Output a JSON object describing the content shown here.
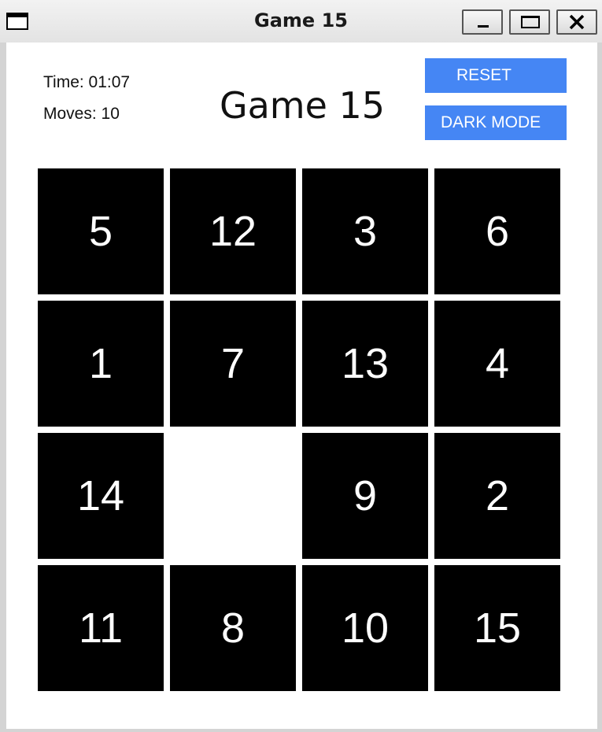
{
  "window": {
    "title": "Game 15"
  },
  "stats": {
    "time": "Time: 01:07",
    "moves": "Moves: 10"
  },
  "header": {
    "title": "Game 15"
  },
  "buttons": {
    "reset": "RESET",
    "dark_mode": "DARK MODE"
  },
  "board": {
    "rows": 4,
    "cols": 4,
    "tiles": [
      "5",
      "12",
      "3",
      "6",
      "1",
      "7",
      "13",
      "4",
      "14",
      "",
      "9",
      "2",
      "11",
      "8",
      "10",
      "15"
    ]
  },
  "colors": {
    "tile": "#000000",
    "tile_text": "#ffffff",
    "button": "#4586f4"
  }
}
